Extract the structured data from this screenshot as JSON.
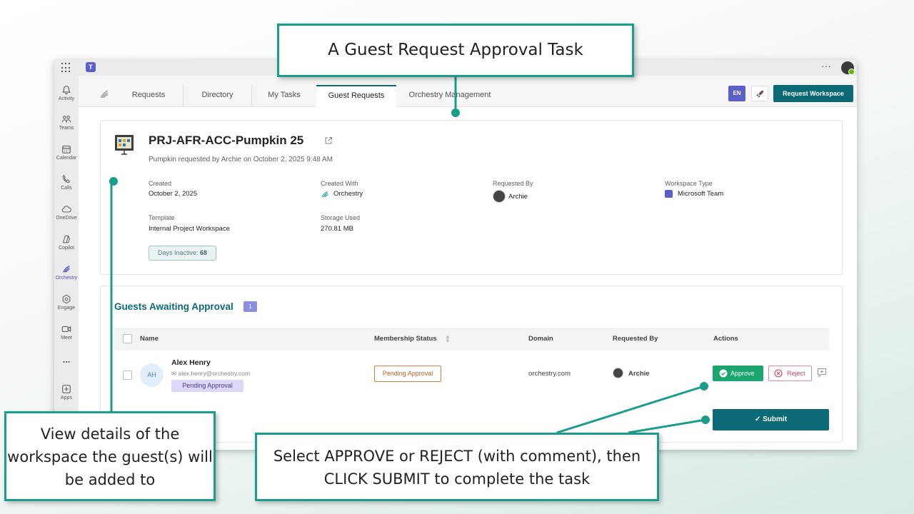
{
  "teams": {
    "rail": [
      {
        "label": "Activity",
        "icon": "bell-icon"
      },
      {
        "label": "Teams",
        "icon": "people-icon"
      },
      {
        "label": "Calendar",
        "icon": "calendar-icon"
      },
      {
        "label": "Calls",
        "icon": "phone-icon"
      },
      {
        "label": "OneDrive",
        "icon": "cloud-icon"
      },
      {
        "label": "Copilot",
        "icon": "copilot-icon"
      },
      {
        "label": "Orchestry",
        "icon": "orchestry-icon",
        "active": true
      },
      {
        "label": "Engage",
        "icon": "engage-icon"
      },
      {
        "label": "Meet",
        "icon": "video-icon"
      },
      {
        "label": "...",
        "icon": "more-icon"
      },
      {
        "label": "Apps",
        "icon": "plus-box-icon"
      }
    ]
  },
  "tabs": [
    "Requests",
    "Directory",
    "My Tasks",
    "Guest Requests",
    "Orchestry Management"
  ],
  "active_tab": "Guest Requests",
  "header": {
    "lang": "EN",
    "request_workspace": "Request Workspace"
  },
  "workspace": {
    "title": "PRJ-AFR-ACC-Pumpkin 25",
    "subtitle": "Pumpkin requested by Archie on October 2, 2025 9:48 AM",
    "created_label": "Created",
    "created_value": "October 2, 2025",
    "created_with_label": "Created With",
    "created_with_value": "Orchestry",
    "requested_by_label": "Requested By",
    "requested_by_value": "Archie",
    "workspace_type_label": "Workspace Type",
    "workspace_type_value": "Microsoft Team",
    "template_label": "Template",
    "template_value": "Internal Project Workspace",
    "storage_label": "Storage Used",
    "storage_value": "270.81 MB",
    "days_inactive_label": "Days Inactive:",
    "days_inactive_value": "68"
  },
  "guests": {
    "title": "Guests Awaiting Approval",
    "count": "1",
    "columns": {
      "name": "Name",
      "status": "Membership Status",
      "domain": "Domain",
      "requested_by": "Requested By",
      "actions": "Actions"
    },
    "rows": [
      {
        "initials": "AH",
        "name": "Alex Henry",
        "email": "alex.henry@orchestry.com",
        "pill": "Pending Approval",
        "status": "Pending Approval",
        "domain": "orchestry.com",
        "requested_by": "Archie"
      }
    ],
    "approve": "Approve",
    "reject": "Reject",
    "submit": "Submit"
  },
  "callouts": {
    "top": "A Guest Request Approval Task",
    "left": "View details of the workspace the guest(s) will be added to",
    "bottom": "Select APPROVE or REJECT (with comment), then CLICK SUBMIT to complete the task"
  },
  "colors": {
    "accent": "#0b6a75",
    "callout_border": "#1a9e8a",
    "approve": "#1da56f",
    "reject": "#d2456a",
    "pending": "#c45e22",
    "teams_purple": "#5b5fc7"
  }
}
